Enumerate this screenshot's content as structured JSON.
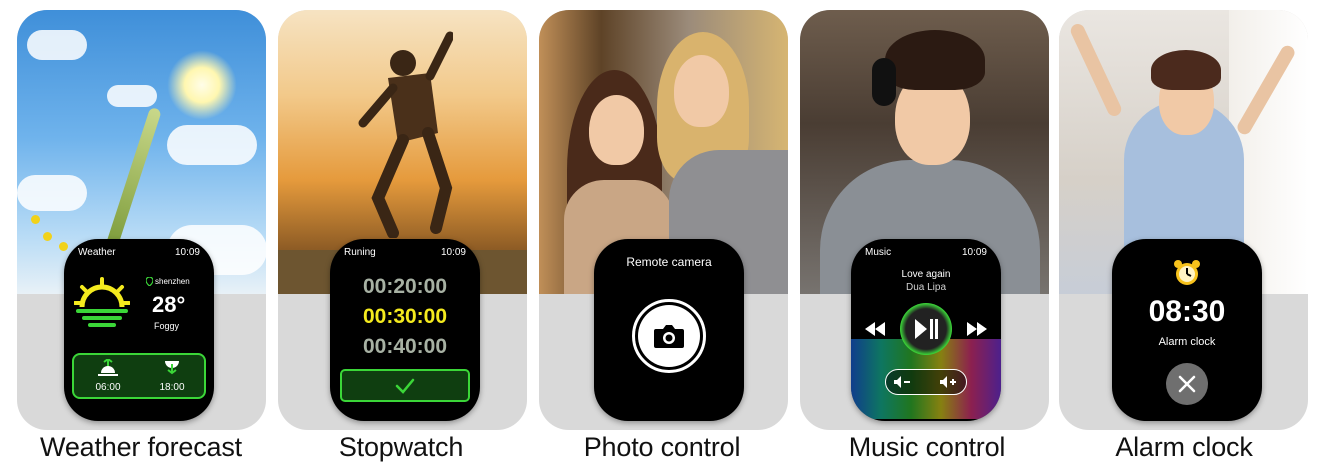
{
  "colors": {
    "green": "#3bd638",
    "yellow": "#f4ea1e",
    "gray_time": "#a7b1a3",
    "watch_bg": "#000000",
    "card_bg": "#d9d9d9"
  },
  "cards": {
    "weather": {
      "label": "Weather forecast",
      "watch": {
        "title": "Weather",
        "time": "10:09",
        "location": "shenzhen",
        "temp": "28°",
        "condition": "Foggy",
        "sunrise": "06:00",
        "sunset": "18:00"
      }
    },
    "stopwatch": {
      "label": "Stopwatch",
      "watch": {
        "title": "Runing",
        "time": "10:09",
        "times": [
          "00:20:00",
          "00:30:00",
          "00:40:00"
        ]
      }
    },
    "photo": {
      "label": "Photo control",
      "watch": {
        "title": "Remote camera"
      }
    },
    "music": {
      "label": "Music control",
      "watch": {
        "title": "Music",
        "time": "10:09",
        "song": "Love again",
        "artist": "Dua Lipa"
      }
    },
    "alarm": {
      "label": "Alarm clock",
      "watch": {
        "clock": "08:30",
        "title": "Alarm clock"
      }
    }
  }
}
